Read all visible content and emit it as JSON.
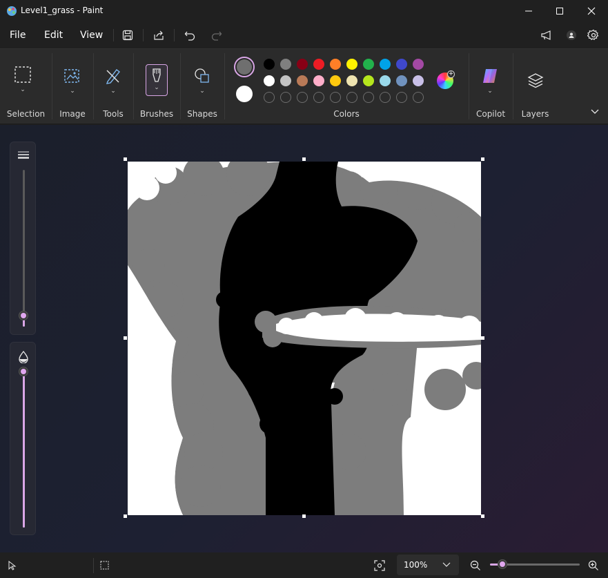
{
  "window": {
    "title": "Level1_grass - Paint"
  },
  "menu": {
    "file": "File",
    "edit": "Edit",
    "view": "View"
  },
  "ribbon": {
    "groups": {
      "selection": "Selection",
      "image": "Image",
      "tools": "Tools",
      "brushes": "Brushes",
      "shapes": "Shapes",
      "colors": "Colors",
      "copilot": "Copilot",
      "layers": "Layers"
    },
    "primary_color": "#6f6f6f",
    "secondary_color": "#ffffff",
    "palette_row1": [
      "#000000",
      "#7f7f7f",
      "#880015",
      "#ed1c24",
      "#ff7f27",
      "#fff200",
      "#22b14c",
      "#00a2e8",
      "#3f48cc",
      "#a349a4"
    ],
    "palette_row2": [
      "#ffffff",
      "#c3c3c3",
      "#b97a57",
      "#ffaec9",
      "#ffc90e",
      "#efe4b0",
      "#b5e61d",
      "#99d9ea",
      "#7092be",
      "#c8bfe7"
    ]
  },
  "sliders": {
    "brush_size": 0.07,
    "opacity": 1.0
  },
  "status": {
    "zoom": "100%",
    "zoom_level": 0.27
  }
}
